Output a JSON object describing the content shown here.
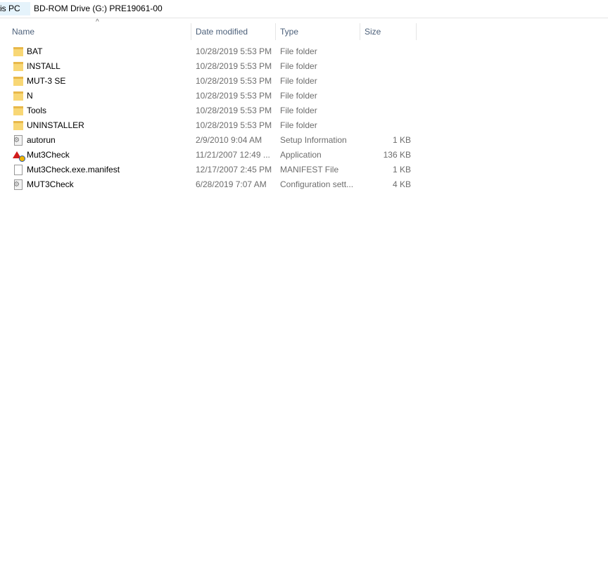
{
  "breadcrumb": {
    "parent": "is PC",
    "current": "BD-ROM Drive (G:) PRE19061-00"
  },
  "columns": {
    "name": "Name",
    "date": "Date modified",
    "type": "Type",
    "size": "Size"
  },
  "files": [
    {
      "name": "BAT",
      "date": "10/28/2019 5:53 PM",
      "type": "File folder",
      "size": "",
      "icon": "folder"
    },
    {
      "name": "INSTALL",
      "date": "10/28/2019 5:53 PM",
      "type": "File folder",
      "size": "",
      "icon": "folder"
    },
    {
      "name": "MUT-3 SE",
      "date": "10/28/2019 5:53 PM",
      "type": "File folder",
      "size": "",
      "icon": "folder"
    },
    {
      "name": "N",
      "date": "10/28/2019 5:53 PM",
      "type": "File folder",
      "size": "",
      "icon": "folder"
    },
    {
      "name": "Tools",
      "date": "10/28/2019 5:53 PM",
      "type": "File folder",
      "size": "",
      "icon": "folder"
    },
    {
      "name": "UNINSTALLER",
      "date": "10/28/2019 5:53 PM",
      "type": "File folder",
      "size": "",
      "icon": "folder"
    },
    {
      "name": "autorun",
      "date": "2/9/2010 9:04 AM",
      "type": "Setup Information",
      "size": "1 KB",
      "icon": "cfg"
    },
    {
      "name": "Mut3Check",
      "date": "11/21/2007 12:49 ...",
      "type": "Application",
      "size": "136 KB",
      "icon": "app"
    },
    {
      "name": "Mut3Check.exe.manifest",
      "date": "12/17/2007 2:45 PM",
      "type": "MANIFEST File",
      "size": "1 KB",
      "icon": "file"
    },
    {
      "name": "MUT3Check",
      "date": "6/28/2019 7:07 AM",
      "type": "Configuration sett...",
      "size": "4 KB",
      "icon": "cfg"
    }
  ]
}
